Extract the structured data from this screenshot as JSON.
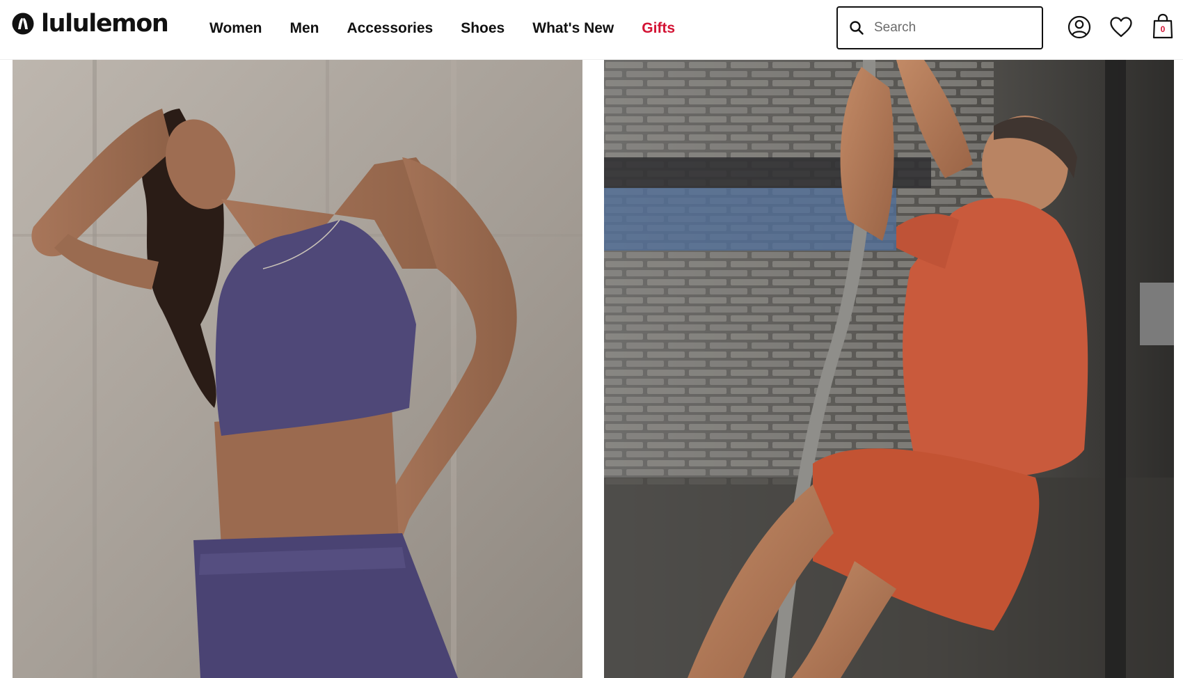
{
  "brand": {
    "name": "lululemon"
  },
  "nav": {
    "items": [
      {
        "label": "Women"
      },
      {
        "label": "Men"
      },
      {
        "label": "Accessories"
      },
      {
        "label": "Shoes"
      },
      {
        "label": "What's New"
      },
      {
        "label": "Gifts"
      }
    ]
  },
  "search": {
    "placeholder": "Search",
    "value": ""
  },
  "utility": {
    "account_icon": "account-icon",
    "wishlist_icon": "heart-icon",
    "bag_icon": "shopping-bag-icon",
    "bag_count": "0"
  },
  "colors": {
    "accent_red": "#d31334",
    "text": "#111111",
    "women_outfit": "#4f4878",
    "men_outfit": "#c95a3c"
  }
}
